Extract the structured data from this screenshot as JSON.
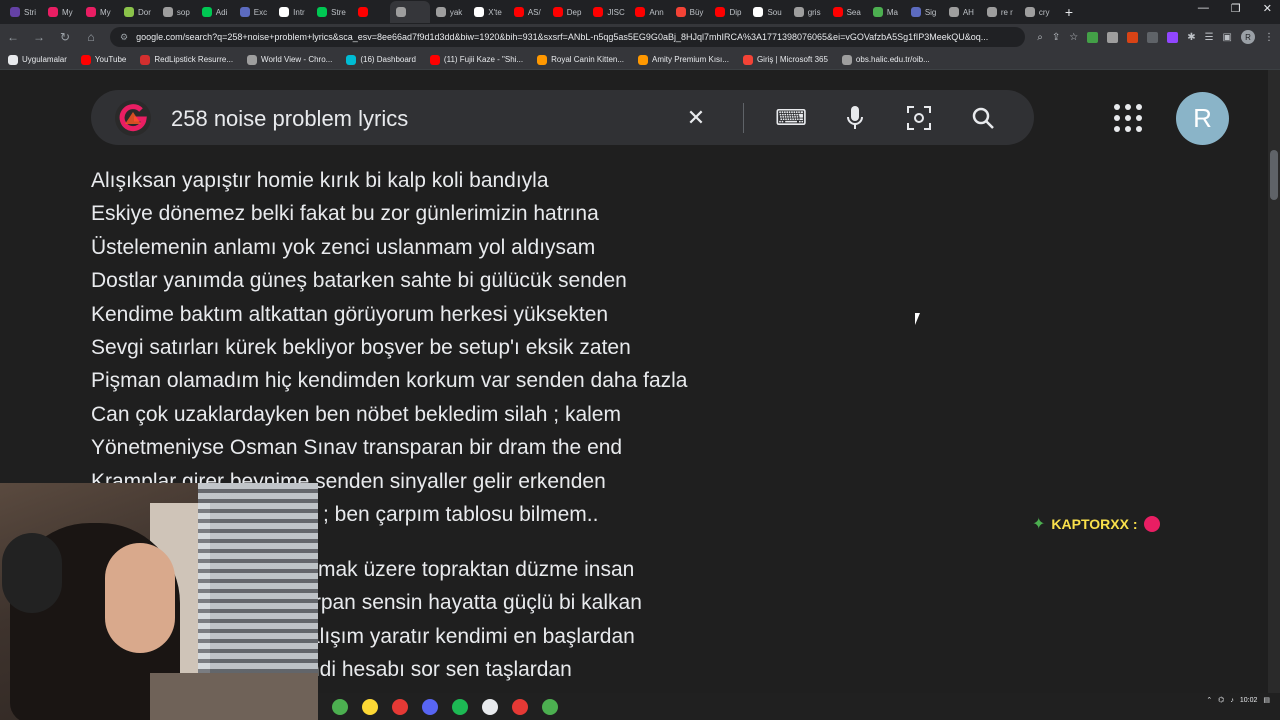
{
  "tabs": [
    {
      "label": "Stri",
      "color": "#6441a5"
    },
    {
      "label": "My",
      "color": "#e91e63"
    },
    {
      "label": "My",
      "color": "#e91e63"
    },
    {
      "label": "Dor",
      "color": "#8bc34a"
    },
    {
      "label": "sop",
      "color": "#9e9e9e"
    },
    {
      "label": "Adi",
      "color": "#00c853"
    },
    {
      "label": "Exc",
      "color": "#5c6bc0"
    },
    {
      "label": "Intr",
      "color": "#ffffff"
    },
    {
      "label": "Stre",
      "color": "#00c853"
    },
    {
      "label": "",
      "color": "#ff0000"
    },
    {
      "label": "",
      "color": "#9e9e9e"
    },
    {
      "label": "yak",
      "color": "#9e9e9e"
    },
    {
      "label": "X'te",
      "color": "#ffffff"
    },
    {
      "label": "AS/",
      "color": "#ff0000"
    },
    {
      "label": "Dep",
      "color": "#ff0000"
    },
    {
      "label": "JISC",
      "color": "#ff0000"
    },
    {
      "label": "Ann",
      "color": "#ff0000"
    },
    {
      "label": "Büy",
      "color": "#f44336"
    },
    {
      "label": "Dip",
      "color": "#ff0000"
    },
    {
      "label": "Sou",
      "color": "#ffffff"
    },
    {
      "label": "gris",
      "color": "#9e9e9e"
    },
    {
      "label": "Sea",
      "color": "#ff0000"
    },
    {
      "label": "Ma",
      "color": "#4caf50"
    },
    {
      "label": "Sig",
      "color": "#5c6bc0"
    },
    {
      "label": "AH",
      "color": "#9e9e9e"
    },
    {
      "label": "re r",
      "color": "#9e9e9e"
    },
    {
      "label": "cry",
      "color": "#9e9e9e"
    }
  ],
  "window_controls": {
    "minimize": "—",
    "restore": "❐",
    "close": "✕"
  },
  "address_bar": {
    "url": "google.com/search?q=258+noise+problem+lyrics&sca_esv=8ee66ad7f9d1d3dd&biw=1920&bih=931&sxsrf=ANbL-n5qg5as5EG9G0aBj_8HJql7mhIRCA%3A1771398076065&ei=vGOVafzbA5Sg1fIP3MeekQU&oq...",
    "profile_initial": "R"
  },
  "bookmarks": [
    {
      "label": "Uygulamalar",
      "color": "#e8eaed"
    },
    {
      "label": "YouTube",
      "color": "#ff0000"
    },
    {
      "label": "RedLipstick Resurre...",
      "color": "#d32f2f"
    },
    {
      "label": "World View - Chro...",
      "color": "#9e9e9e"
    },
    {
      "label": "(16) Dashboard",
      "color": "#00bcd4"
    },
    {
      "label": "(11) Fujii Kaze - \"Shi...",
      "color": "#ff0000"
    },
    {
      "label": "Royal Canin Kitten...",
      "color": "#ff9800"
    },
    {
      "label": "Amity Premium Kısı...",
      "color": "#ff9800"
    },
    {
      "label": "Giriş | Microsoft 365",
      "color": "#f44336"
    },
    {
      "label": "obs.halic.edu.tr/oib...",
      "color": "#9e9e9e"
    }
  ],
  "search": {
    "query": "258 noise problem lyrics",
    "profile_initial": "R"
  },
  "lyrics": {
    "lines": [
      "Alışıksan yapıştır homie kırık bi kalp koli bandıyla",
      "Eskiye dönemez belki fakat bu zor günlerimizin hatrına",
      "Üstelemenin anlamı yok zenci uslanmam yol aldıysam",
      "Dostlar yanımda güneş batarken sahte bi gülücük senden",
      "Kendime baktım altkattan görüyorum herkesi yüksekten",
      "Sevgi satırları kürek bekliyor boşver be setup'ı eksik zaten",
      "Pişman olamadım hiç kendimden korkum var senden daha fazla",
      "Can çok uzaklardayken ben nöbet bekledim silah ; kalem",
      "Yönetmeniyse Osman Sınav transparan bir dram the end",
      "Kramplar girer beynime senden sinyaller gelir erkenden",
      "; ben çarpım tablosu bilmem.."
    ],
    "stanza2": [
      "mak üzere topraktan düzme insan",
      "ırpan sensin hayatta güçlü bi kalkan",
      "alışım yaratır kendimi en başlardan",
      "ndi hesabı sor sen taşlardan"
    ]
  },
  "chat": {
    "username": "KAPTORXX :"
  },
  "taskbar": {
    "icons": [
      {
        "name": "chrome-icon",
        "color": "#4caf50"
      },
      {
        "name": "files-icon",
        "color": "#fdd835"
      },
      {
        "name": "app-icon",
        "color": "#e53935"
      },
      {
        "name": "discord-icon",
        "color": "#5865f2"
      },
      {
        "name": "spotify-icon",
        "color": "#1db954"
      },
      {
        "name": "steam-icon",
        "color": "#e8eaed"
      },
      {
        "name": "obs-icon",
        "color": "#e53935"
      },
      {
        "name": "chrome-alt-icon",
        "color": "#4caf50"
      }
    ],
    "clock": "10:02"
  }
}
